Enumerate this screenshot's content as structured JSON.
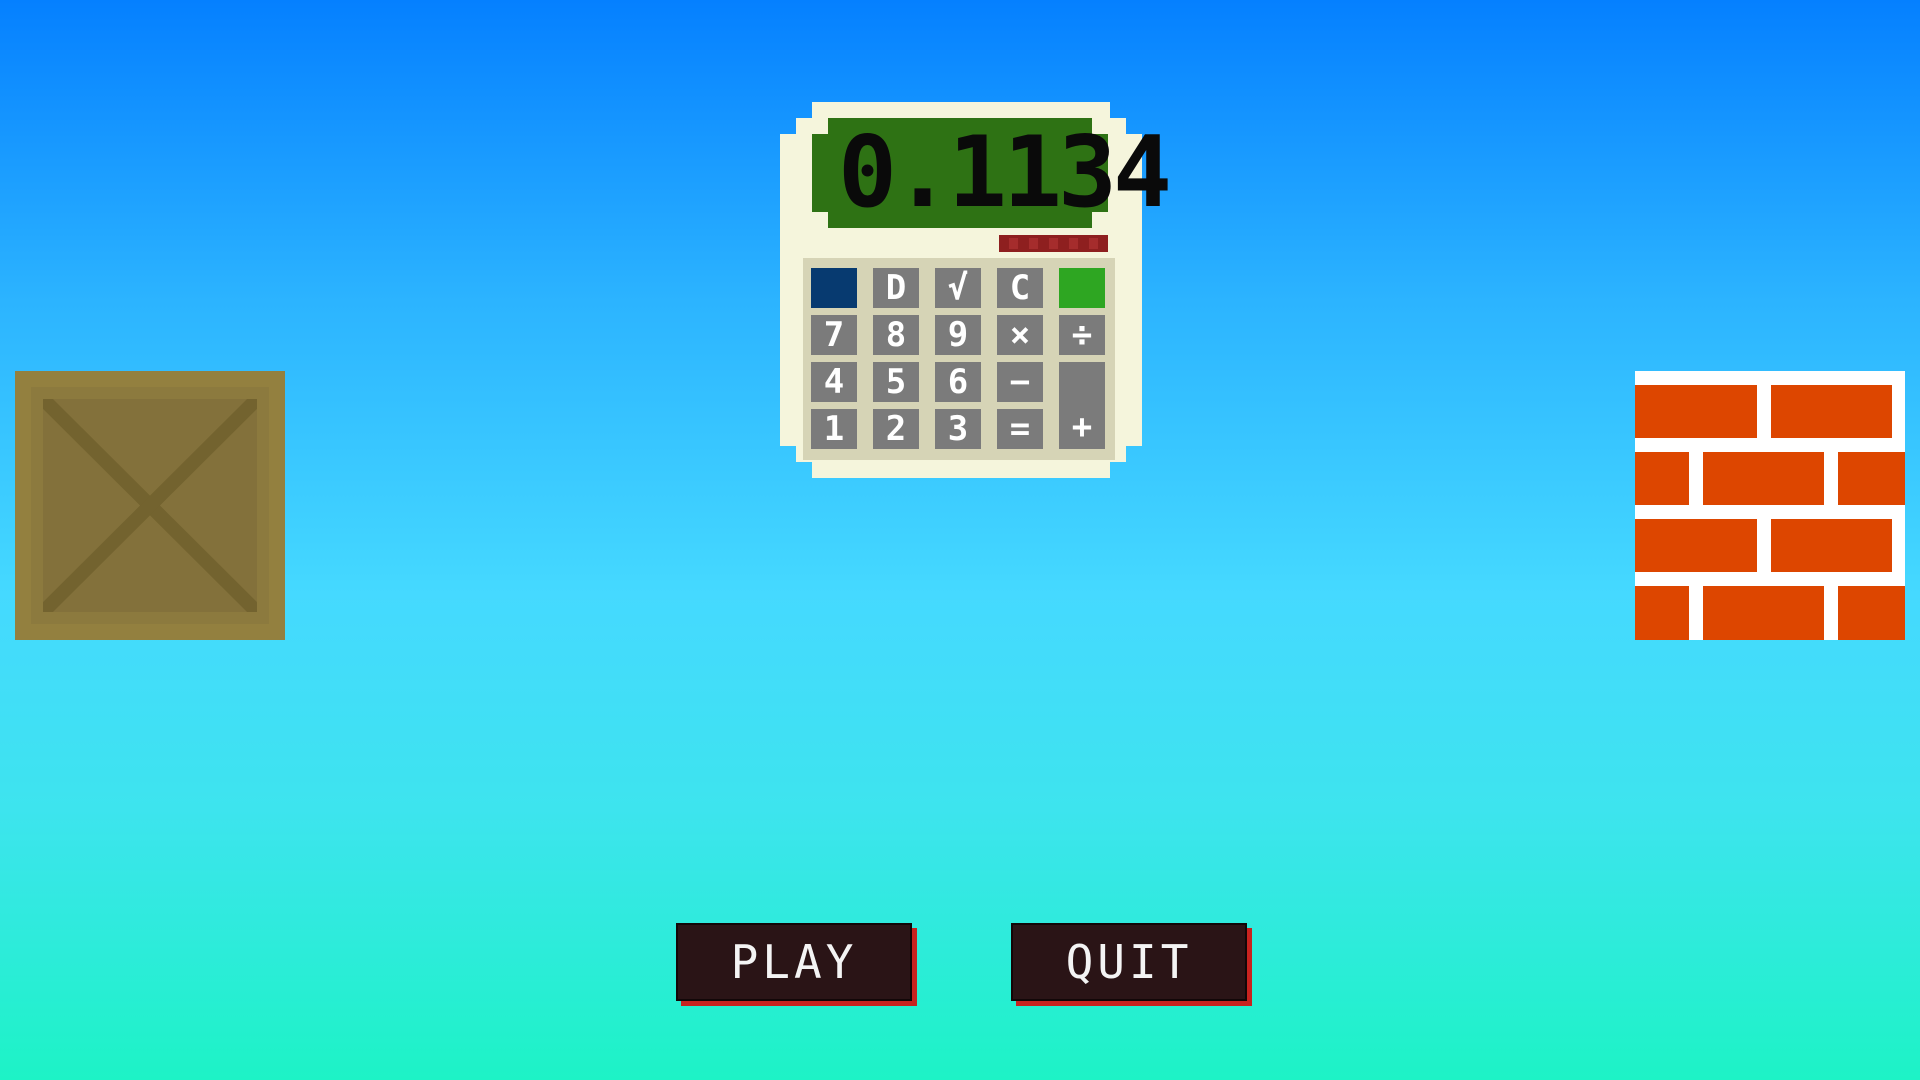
{
  "menu": {
    "play_label": "PLAY",
    "quit_label": "QUIT"
  },
  "calculator_logo": {
    "display_value": "0.1134",
    "keys": [
      [
        "",
        "D",
        "√",
        "C",
        ""
      ],
      [
        "7",
        "8",
        "9",
        "×",
        "÷"
      ],
      [
        "4",
        "5",
        "6",
        "−",
        "+"
      ],
      [
        "1",
        "2",
        "3",
        "="
      ]
    ]
  },
  "colors": {
    "sky_top": "#0580ff",
    "sky_bottom": "#1df3c6",
    "display_green": "#2e7214",
    "calculator_body": "#f5f5dc",
    "key_gray": "#7b7b7b",
    "key_blue": "#073a70",
    "key_green": "#2ea622",
    "crate_brown": "#8c7a3e",
    "brick_orange": "#dd4600",
    "button_dark": "#2a1416",
    "button_shadow_red": "#c8231f"
  }
}
